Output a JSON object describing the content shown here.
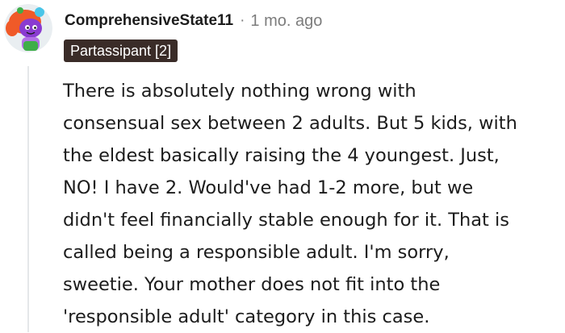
{
  "comment": {
    "username": "ComprehensiveState11",
    "separator": "·",
    "time_ago": "1 mo. ago",
    "flair": "Partassipant [2]",
    "body_lines": [
      "There is absolutely nothing wrong with",
      "consensual sex between 2 adults. But 5 kids, with",
      "the eldest basically raising the 4 youngest. Just,",
      "NO! I have 2. Would've had 1-2 more, but we",
      "didn't feel financially stable enough for it. That is",
      "called being a responsible adult. I'm sorry,",
      "sweetie. Your mother does not fit into the",
      "'responsible adult' category in this case."
    ]
  },
  "colors": {
    "flair_background": "#3a2c28",
    "muted_text": "#7c7c7c",
    "thread_line": "#e5e7e9",
    "avatar_body": "#8a3bd1",
    "avatar_hair": "#f05a28",
    "avatar_shirt": "#3fae49"
  },
  "icons": {
    "avatar": "snoo-avatar-icon"
  }
}
